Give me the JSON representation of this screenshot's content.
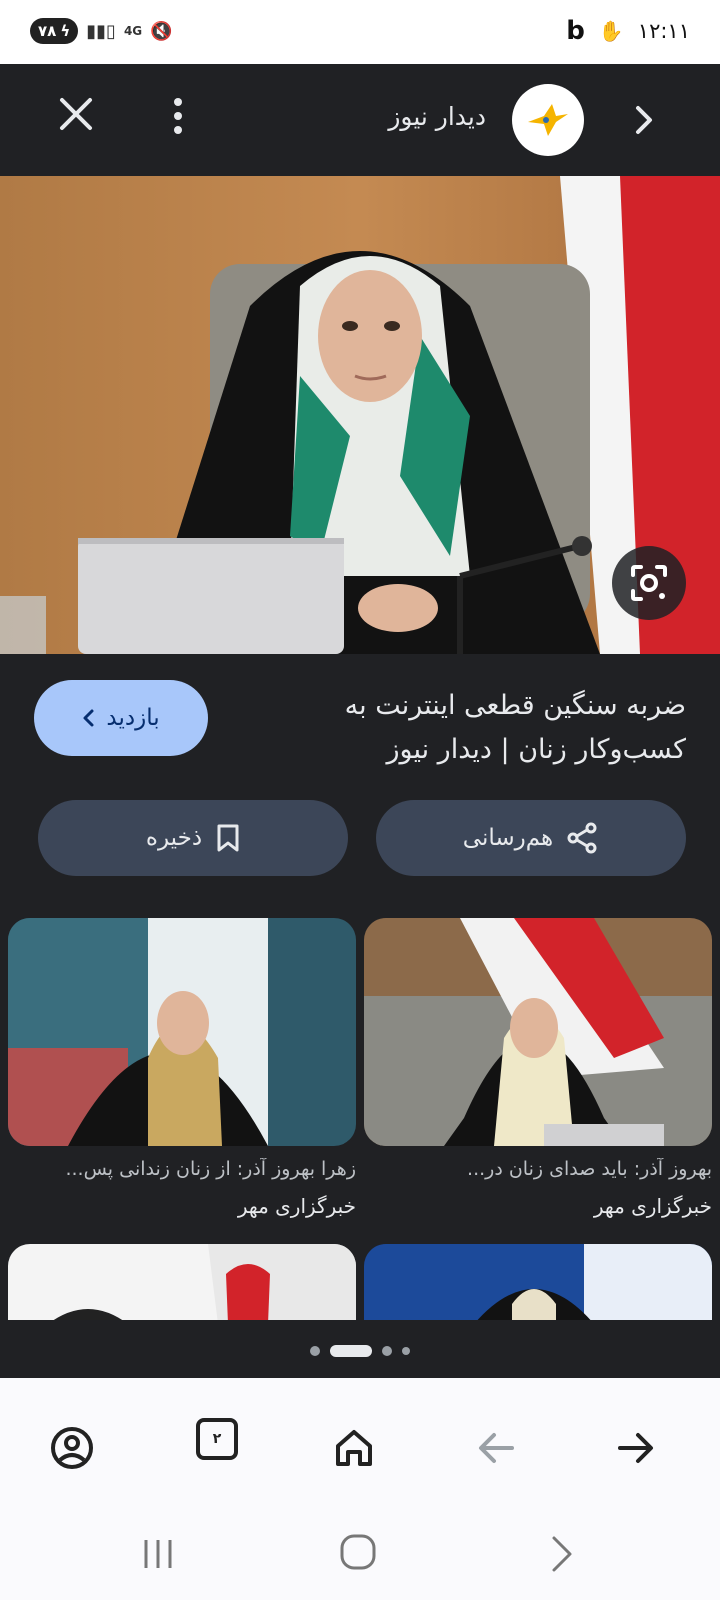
{
  "status_bar": {
    "battery": "۷۸",
    "network": "4G",
    "time": "۱۲:۱۱",
    "app_letter": "b"
  },
  "viewer": {
    "source_name": "دیدار نیوز",
    "headline": "ضربه سنگین قطعی اینترنت به کسب‌وکار زنان | دیدار نیوز",
    "visit_label": "بازدید",
    "share_label": "هم‌رسانی",
    "save_label": "ذخیره"
  },
  "related": [
    {
      "caption": "بهروز آذر: باید صدای زنان در...",
      "source": "خبرگزاری مهر"
    },
    {
      "caption": "زهرا بهروز آذر: از زنان زندانی پس...",
      "source": "خبرگزاری مهر"
    }
  ],
  "browser": {
    "tab_count": "۲"
  },
  "colors": {
    "background": "#202124",
    "visit_button": "#a8c7fa",
    "pill_button": "#3c4658"
  },
  "icons": [
    "close-icon",
    "more-vert-icon",
    "chevron-right-icon",
    "lens-icon",
    "share-icon",
    "bookmark-icon",
    "account-icon",
    "home-icon",
    "back-arrow-icon",
    "forward-arrow-icon"
  ]
}
